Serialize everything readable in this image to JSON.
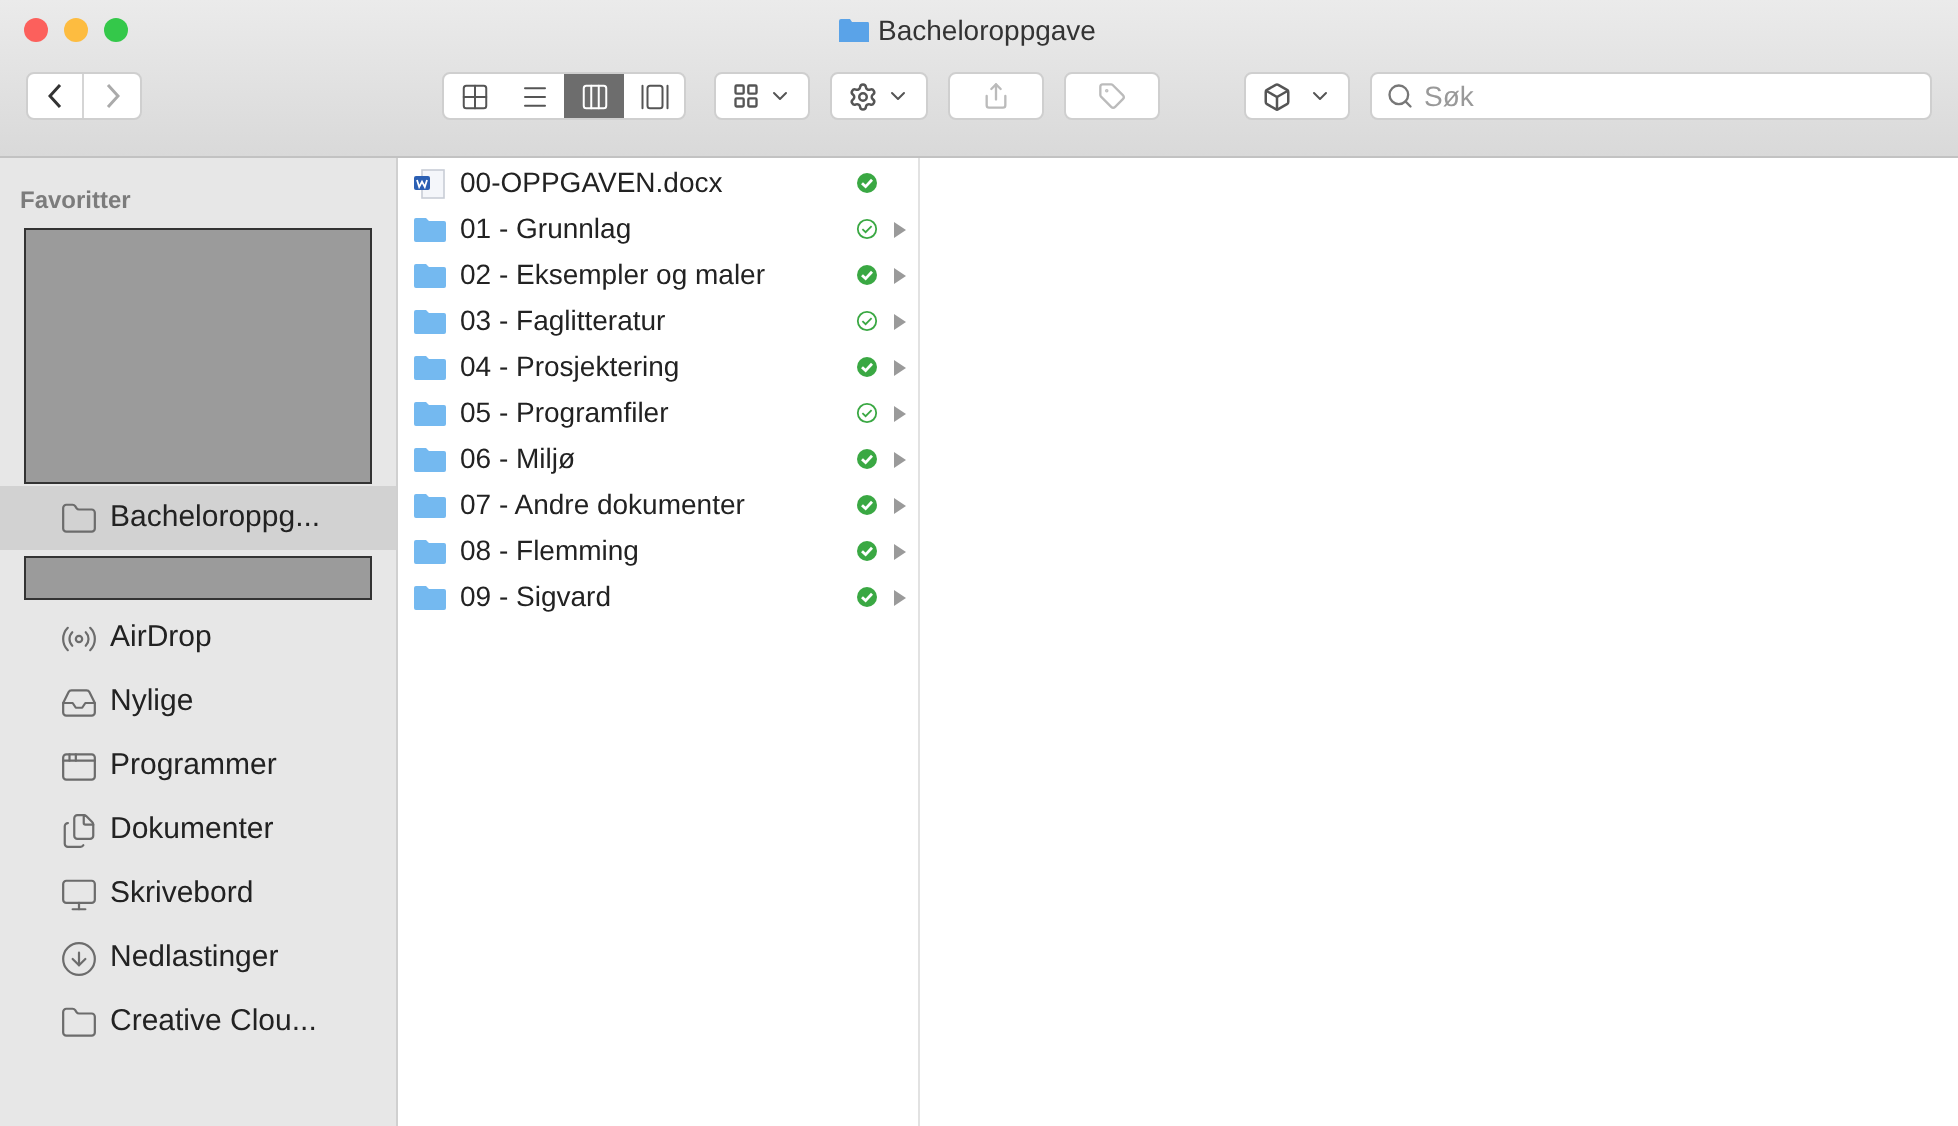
{
  "window": {
    "title": "Bacheloroppgave"
  },
  "view_modes": [
    {
      "kind": "icons",
      "selected": false
    },
    {
      "kind": "list",
      "selected": false
    },
    {
      "kind": "columns",
      "selected": true
    },
    {
      "kind": "gallery",
      "selected": false
    }
  ],
  "search": {
    "placeholder": "Søk"
  },
  "sidebar": {
    "heading": "Favoritter",
    "items": [
      {
        "kind": "redaction",
        "selected": false,
        "tall": true
      },
      {
        "kind": "folder",
        "label": "Bacheloroppg...",
        "selected": true
      },
      {
        "kind": "redaction",
        "selected": false,
        "tall": false
      },
      {
        "kind": "airdrop",
        "label": "AirDrop",
        "selected": false
      },
      {
        "kind": "recent",
        "label": "Nylige",
        "selected": false
      },
      {
        "kind": "apps",
        "label": "Programmer",
        "selected": false
      },
      {
        "kind": "documents",
        "label": "Dokumenter",
        "selected": false
      },
      {
        "kind": "desktop",
        "label": "Skrivebord",
        "selected": false
      },
      {
        "kind": "downloads",
        "label": "Nedlastinger",
        "selected": false
      },
      {
        "kind": "folder",
        "label": "Creative Clou...",
        "selected": false
      }
    ]
  },
  "files": [
    {
      "kind": "document",
      "name": "00-OPPGAVEN.docx",
      "downloaded": true
    },
    {
      "kind": "folder",
      "name": "01 - Grunnlag",
      "downloaded": false
    },
    {
      "kind": "folder",
      "name": "02 - Eksempler og maler",
      "downloaded": true
    },
    {
      "kind": "folder",
      "name": "03 - Faglitteratur",
      "downloaded": false
    },
    {
      "kind": "folder",
      "name": "04 - Prosjektering",
      "downloaded": true
    },
    {
      "kind": "folder",
      "name": "05 - Programfiler",
      "downloaded": false
    },
    {
      "kind": "folder",
      "name": "06 - Miljø",
      "downloaded": true
    },
    {
      "kind": "folder",
      "name": "07 - Andre dokumenter",
      "downloaded": true
    },
    {
      "kind": "folder",
      "name": "08 - Flemming",
      "downloaded": true
    },
    {
      "kind": "folder",
      "name": "09 - Sigvard",
      "downloaded": true
    }
  ]
}
